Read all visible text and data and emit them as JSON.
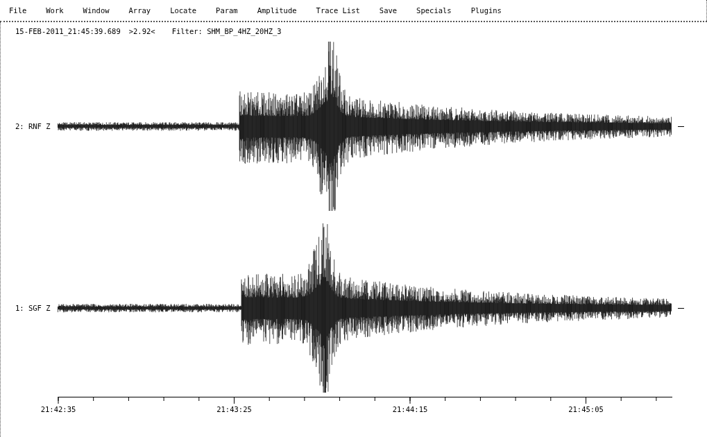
{
  "menu": [
    "File",
    "Work",
    "Window",
    "Array",
    "Locate",
    "Param",
    "Amplitude",
    "Trace List",
    "Save",
    "Specials",
    "Plugins"
  ],
  "header": {
    "time": "15-FEB-2011_21:45:39.689",
    "zoom": ">2.92<",
    "filter": "Filter: SHM_BP_4HZ_20HZ_3"
  },
  "traces": [
    {
      "label": "2: RNF Z"
    },
    {
      "label": "1: SGF Z"
    }
  ],
  "axis": {
    "ticks": [
      "21:42:35",
      "21:43:25",
      "21:44:15",
      "21:45:05"
    ]
  }
}
